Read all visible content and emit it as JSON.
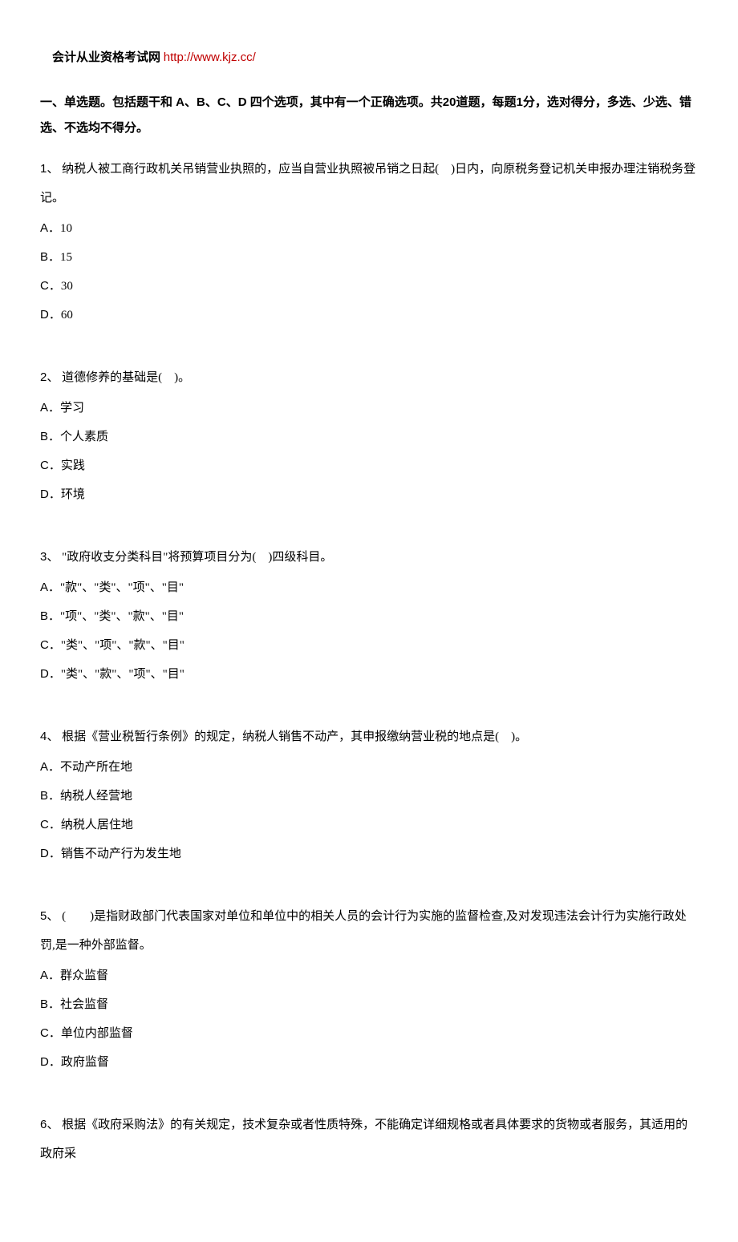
{
  "header": {
    "title": "会计从业资格考试网",
    "link": "http://www.kjz.cc/"
  },
  "instructions": "一、单选题。包括题干和 A、B、C、D 四个选项，其中有一个正确选项。共20道题，每题1分，选对得分，多选、少选、错选、不选均不得分。",
  "questions": [
    {
      "num": "1、",
      "text": " 纳税人被工商行政机关吊销营业执照的，应当自营业执照被吊销之日起(　)日内，向原税务登记机关申报办理注销税务登记。",
      "options": [
        {
          "letter": "A．",
          "text": "10"
        },
        {
          "letter": "B．",
          "text": "15"
        },
        {
          "letter": "C．",
          "text": "30"
        },
        {
          "letter": "D．",
          "text": "60"
        }
      ]
    },
    {
      "num": "2、",
      "text": " 道德修养的基础是(　)。",
      "options": [
        {
          "letter": "A．",
          "text": "学习"
        },
        {
          "letter": "B．",
          "text": "个人素质"
        },
        {
          "letter": "C．",
          "text": "实践"
        },
        {
          "letter": "D．",
          "text": "环境"
        }
      ]
    },
    {
      "num": "3、",
      "text": " \"政府收支分类科目\"将预算项目分为(　)四级科目。",
      "options": [
        {
          "letter": "A．",
          "text": "\"款\"、\"类\"、\"项\"、\"目\""
        },
        {
          "letter": "B．",
          "text": "\"项\"、\"类\"、\"款\"、\"目\""
        },
        {
          "letter": "C．",
          "text": "\"类\"、\"项\"、\"款\"、\"目\""
        },
        {
          "letter": "D．",
          "text": "\"类\"、\"款\"、\"项\"、\"目\""
        }
      ]
    },
    {
      "num": "4、",
      "text": " 根据《营业税暂行条例》的规定，纳税人销售不动产，其申报缴纳营业税的地点是(　)。",
      "options": [
        {
          "letter": "A．",
          "text": "不动产所在地"
        },
        {
          "letter": "B．",
          "text": "纳税人经营地"
        },
        {
          "letter": "C．",
          "text": "纳税人居住地"
        },
        {
          "letter": "D．",
          "text": "销售不动产行为发生地"
        }
      ]
    },
    {
      "num": "5、",
      "text": " (　　)是指财政部门代表国家对单位和单位中的相关人员的会计行为实施的监督检查,及对发现违法会计行为实施行政处罚,是一种外部监督。",
      "options": [
        {
          "letter": "A．",
          "text": "群众监督"
        },
        {
          "letter": "B．",
          "text": "社会监督"
        },
        {
          "letter": "C．",
          "text": "单位内部监督"
        },
        {
          "letter": "D．",
          "text": "政府监督"
        }
      ]
    },
    {
      "num": "6、",
      "text": " 根据《政府采购法》的有关规定，技术复杂或者性质特殊，不能确定详细规格或者具体要求的货物或者服务，其适用的政府采",
      "options": []
    }
  ]
}
